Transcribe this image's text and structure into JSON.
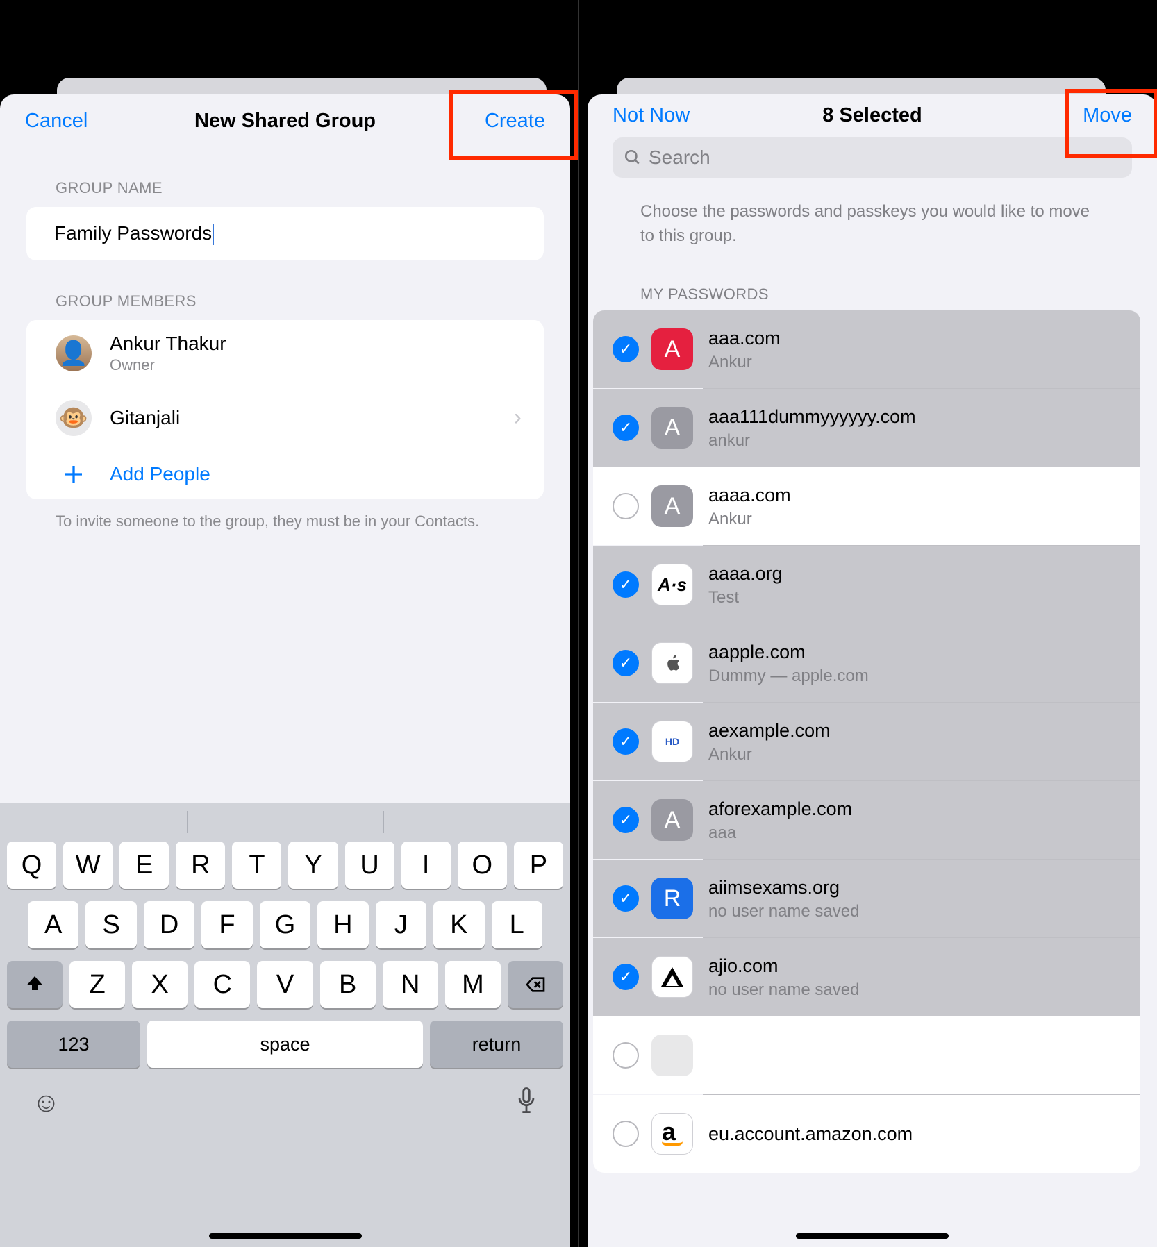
{
  "left": {
    "nav": {
      "cancel": "Cancel",
      "title": "New Shared Group",
      "action": "Create"
    },
    "group_name_label": "GROUP NAME",
    "group_name_value": "Family Passwords",
    "group_members_label": "GROUP MEMBERS",
    "members": [
      {
        "name": "Ankur Thakur",
        "sub": "Owner"
      },
      {
        "name": "Gitanjali",
        "sub": ""
      }
    ],
    "add_people": "Add People",
    "footer": "To invite someone to the group, they must be in your Contacts.",
    "keyboard": {
      "row1": [
        "Q",
        "W",
        "E",
        "R",
        "T",
        "Y",
        "U",
        "I",
        "O",
        "P"
      ],
      "row2": [
        "A",
        "S",
        "D",
        "F",
        "G",
        "H",
        "J",
        "K",
        "L"
      ],
      "row3": [
        "Z",
        "X",
        "C",
        "V",
        "B",
        "N",
        "M"
      ],
      "num": "123",
      "space": "space",
      "return": "return"
    }
  },
  "right": {
    "nav": {
      "cancel": "Not Now",
      "title": "8 Selected",
      "action": "Move"
    },
    "search_placeholder": "Search",
    "choose_note": "Choose the passwords and passkeys you would like to move to this group.",
    "section_label": "MY PASSWORDS",
    "rows": [
      {
        "domain": "aaa.com",
        "user": "Ankur",
        "selected": true,
        "icon": {
          "bg": "#e5203f",
          "label": "A"
        }
      },
      {
        "domain": "aaa111dummyyyyyy.com",
        "user": "ankur",
        "selected": true,
        "icon": {
          "bg": "#9a9aa2",
          "label": "A"
        }
      },
      {
        "domain": "aaaa.com",
        "user": "Ankur",
        "selected": false,
        "icon": {
          "bg": "#9a9aa2",
          "label": "A"
        }
      },
      {
        "domain": "aaaa.org",
        "user": "Test",
        "selected": true,
        "icon": {
          "bg": "#ffffff",
          "label": "A·s",
          "fg": "#000"
        }
      },
      {
        "domain": "aapple.com",
        "user": "Dummy — apple.com",
        "selected": true,
        "icon": {
          "bg": "#ffffff",
          "label": "",
          "fg": "#555"
        }
      },
      {
        "domain": "aexample.com",
        "user": "Ankur",
        "selected": true,
        "icon": {
          "bg": "#ffffff",
          "label": "HD",
          "fg": "#2a5bc5"
        }
      },
      {
        "domain": "aforexample.com",
        "user": "aaa",
        "selected": true,
        "icon": {
          "bg": "#9a9aa2",
          "label": "A"
        }
      },
      {
        "domain": "aiimsexams.org",
        "user": "no user name saved",
        "selected": true,
        "icon": {
          "bg": "#1b6fe8",
          "label": "R"
        }
      },
      {
        "domain": "ajio.com",
        "user": "no user name saved",
        "selected": true,
        "icon": {
          "bg": "#ffffff",
          "label": "A",
          "fg": "#000"
        }
      },
      {
        "domain": "",
        "user": "",
        "selected": false,
        "icon": {
          "bg": "#e8e8e9",
          "label": ""
        }
      },
      {
        "domain": "eu.account.amazon.com",
        "user": "",
        "selected": false,
        "icon": {
          "bg": "#ffffff",
          "label": "a",
          "fg": "#000"
        }
      }
    ]
  }
}
